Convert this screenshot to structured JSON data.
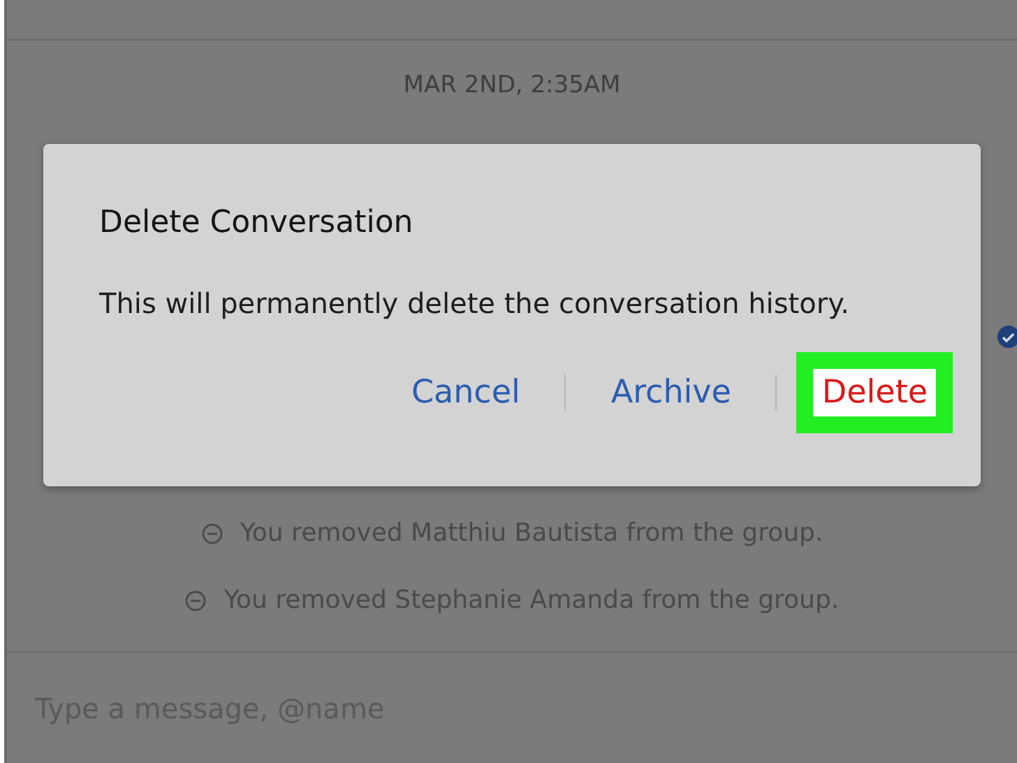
{
  "timestamp": "MAR 2ND, 2:35AM",
  "events": [
    {
      "text": "You removed Matthiu Bautista from the group."
    },
    {
      "text": "You removed Stephanie Amanda from the group."
    }
  ],
  "composer": {
    "placeholder": "Type a message, @name"
  },
  "dialog": {
    "title": "Delete Conversation",
    "message": "This will permanently delete the conversation history.",
    "buttons": [
      {
        "label": "Cancel",
        "kind": "link",
        "highlighted": false
      },
      {
        "label": "Archive",
        "kind": "link",
        "highlighted": false
      },
      {
        "label": "Delete",
        "kind": "danger",
        "highlighted": true
      }
    ]
  }
}
